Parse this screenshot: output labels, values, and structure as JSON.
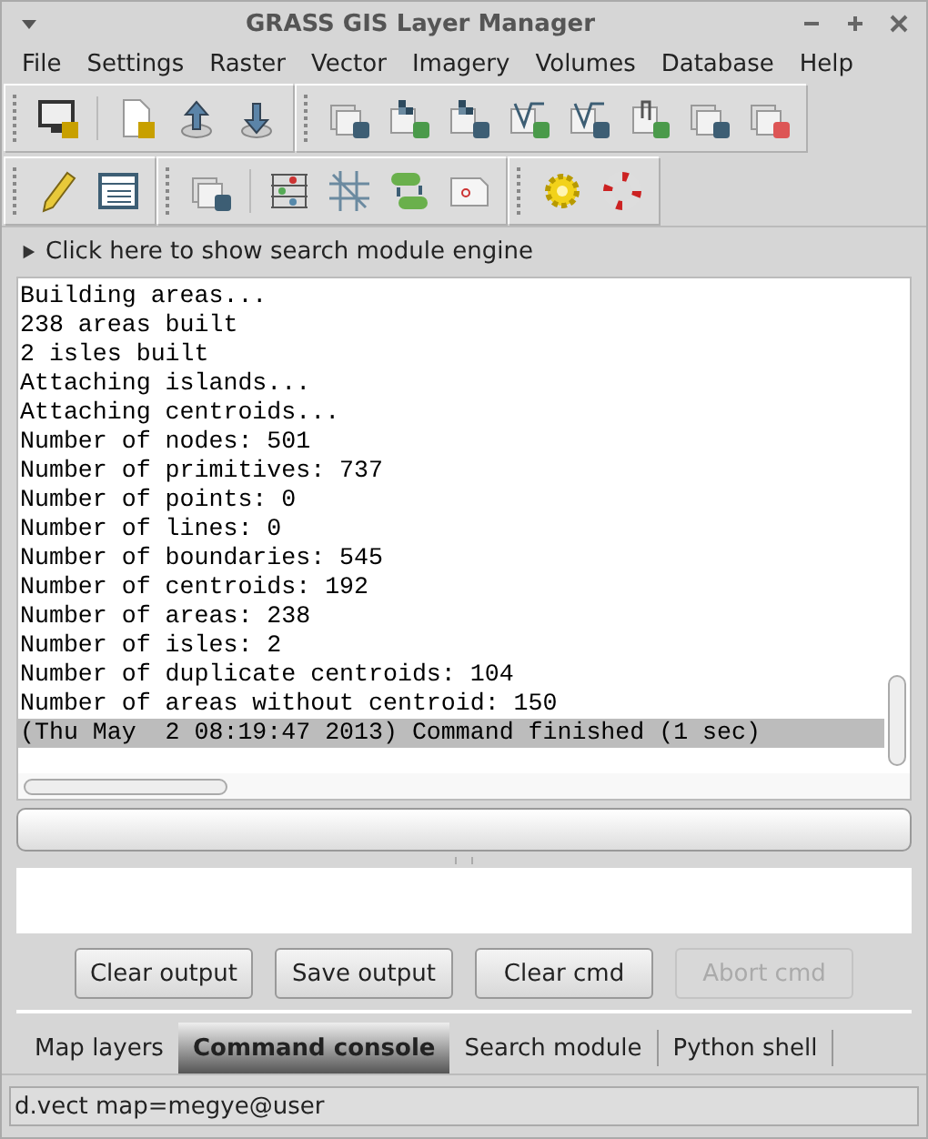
{
  "window": {
    "title": "GRASS GIS Layer Manager"
  },
  "menu": [
    "File",
    "Settings",
    "Raster",
    "Vector",
    "Imagery",
    "Volumes",
    "Database",
    "Help"
  ],
  "search_toggle": {
    "label": "Click here to show search module engine",
    "expanded": false
  },
  "output": [
    {
      "text": "Building areas...",
      "selected": false
    },
    {
      "text": "238 areas built",
      "selected": false
    },
    {
      "text": "2 isles built",
      "selected": false
    },
    {
      "text": "Attaching islands...",
      "selected": false
    },
    {
      "text": "Attaching centroids...",
      "selected": false
    },
    {
      "text": "Number of nodes: 501",
      "selected": false
    },
    {
      "text": "Number of primitives: 737",
      "selected": false
    },
    {
      "text": "Number of points: 0",
      "selected": false
    },
    {
      "text": "Number of lines: 0",
      "selected": false
    },
    {
      "text": "Number of boundaries: 545",
      "selected": false
    },
    {
      "text": "Number of centroids: 192",
      "selected": false
    },
    {
      "text": "Number of areas: 238",
      "selected": false
    },
    {
      "text": "Number of isles: 2",
      "selected": false
    },
    {
      "text": "Number of duplicate centroids: 104",
      "selected": false
    },
    {
      "text": "Number of areas without centroid: 150",
      "selected": false
    },
    {
      "text": "(Thu May  2 08:19:47 2013) Command finished (1 sec)",
      "selected": true
    }
  ],
  "progress": {
    "level": 0
  },
  "buttons": [
    {
      "label": "Clear output",
      "disabled": false
    },
    {
      "label": "Save output",
      "disabled": false
    },
    {
      "label": "Clear cmd",
      "disabled": false
    },
    {
      "label": "Abort cmd",
      "disabled": true
    }
  ],
  "tabs": [
    {
      "label": "Map layers",
      "selected": false
    },
    {
      "label": "Command console",
      "selected": true
    },
    {
      "label": "Search module",
      "selected": false
    },
    {
      "label": "Python shell",
      "selected": false
    }
  ],
  "status_bar": "d.vect map=megye@user"
}
